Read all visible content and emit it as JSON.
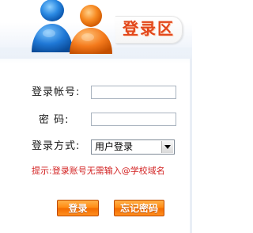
{
  "header": {
    "title": "登录区",
    "logo_icon": "two-people-icon"
  },
  "form": {
    "account_label": "登录帐号:",
    "password_label": "密 码:",
    "method_label": "登录方式:",
    "account_value": "",
    "password_value": "",
    "method_selected": "用户登录",
    "hint": "提示:登录账号无需输入@学校域名"
  },
  "buttons": {
    "login_label": "登录",
    "forgot_label": "忘记密码"
  },
  "colors": {
    "title": "#e2471b",
    "hint": "#d21f1f",
    "button": "#ff8a12",
    "person_blue": "#1f78d6",
    "person_orange": "#f47a1c"
  }
}
